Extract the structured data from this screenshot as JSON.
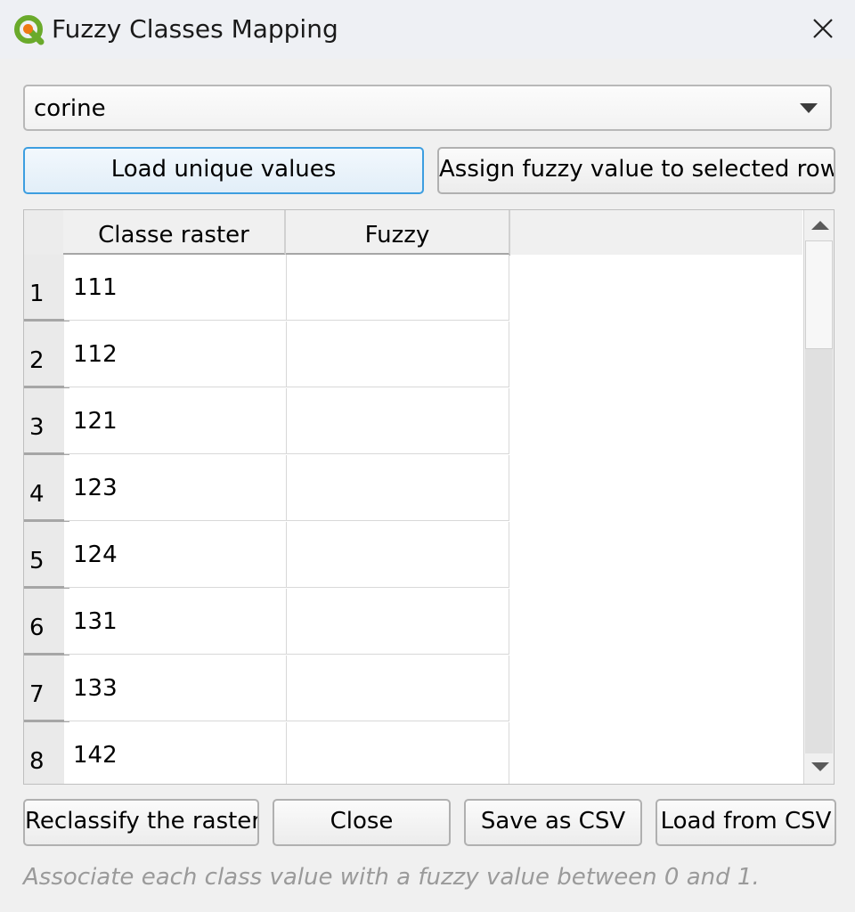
{
  "window": {
    "title": "Fuzzy Classes Mapping"
  },
  "layer_select": {
    "value": "corine"
  },
  "top_buttons": {
    "load_unique": "Load unique values",
    "assign_fuzzy": "Assign fuzzy value to selected rows"
  },
  "table": {
    "columns": [
      "Classe raster",
      "Fuzzy"
    ],
    "rows": [
      {
        "num": "1",
        "classe": "111",
        "fuzzy": ""
      },
      {
        "num": "2",
        "classe": "112",
        "fuzzy": ""
      },
      {
        "num": "3",
        "classe": "121",
        "fuzzy": ""
      },
      {
        "num": "4",
        "classe": "123",
        "fuzzy": ""
      },
      {
        "num": "5",
        "classe": "124",
        "fuzzy": ""
      },
      {
        "num": "6",
        "classe": "131",
        "fuzzy": ""
      },
      {
        "num": "7",
        "classe": "133",
        "fuzzy": ""
      },
      {
        "num": "8",
        "classe": "142",
        "fuzzy": ""
      }
    ]
  },
  "bottom_buttons": {
    "reclassify": "Reclassify the raster",
    "close": "Close",
    "save_csv": "Save as CSV",
    "load_csv": "Load from CSV"
  },
  "hint": "Associate each class value with a fuzzy value between 0 and 1.",
  "icons": {
    "app": "qgis-logo-icon",
    "close": "close-icon",
    "dropdown": "chevron-down-icon"
  },
  "colors": {
    "focus_border": "#3d9ee0",
    "qgis_green": "#6aaa2b",
    "qgis_orange": "#ee7913"
  }
}
